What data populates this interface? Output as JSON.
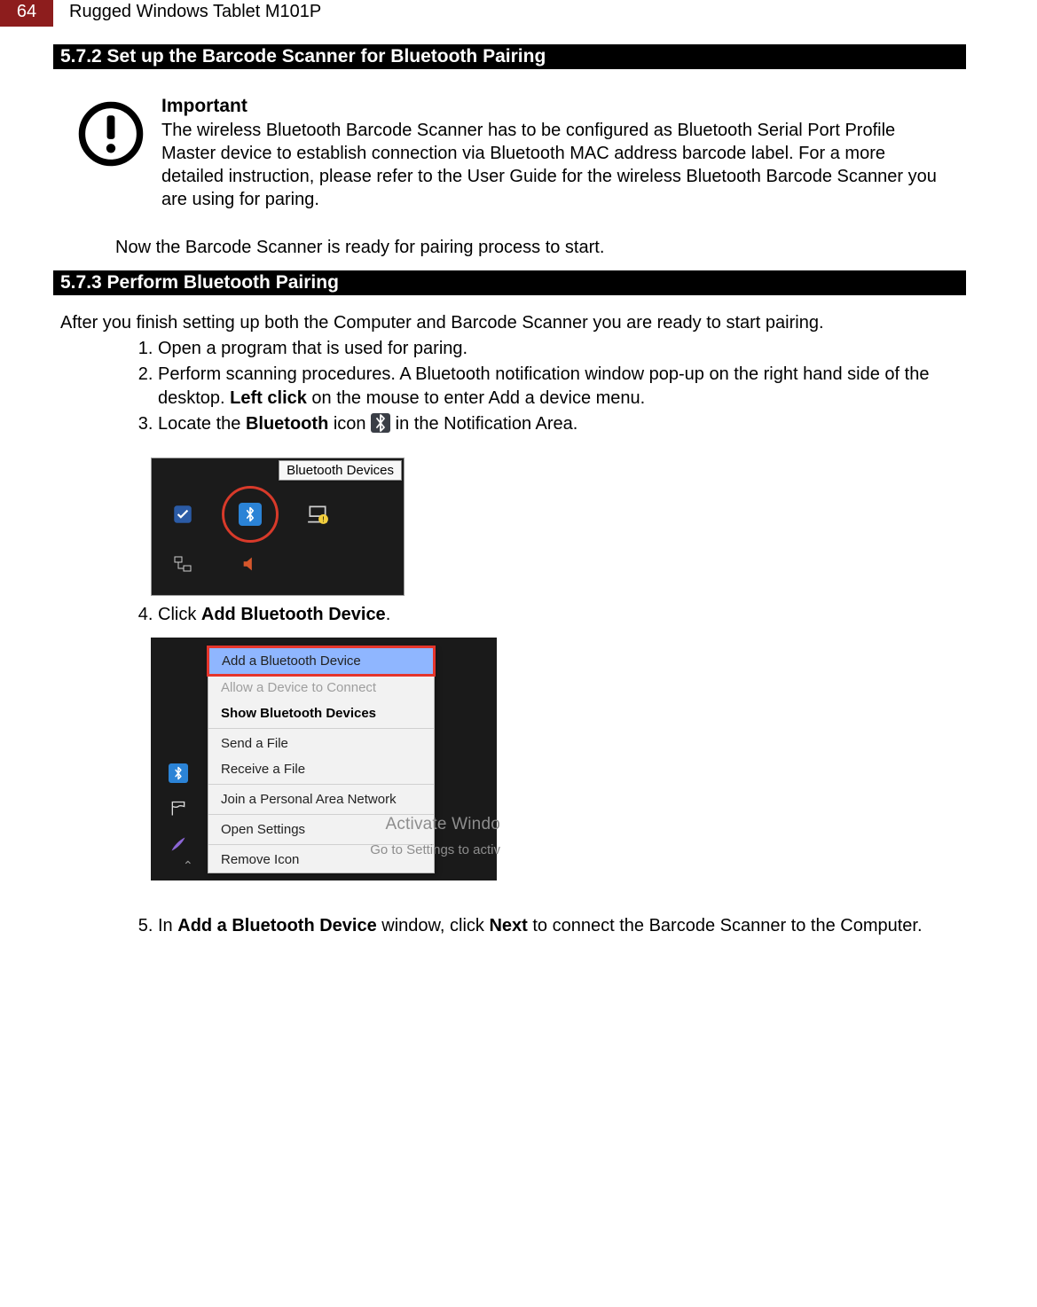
{
  "header": {
    "page_number": "64",
    "title": "Rugged Windows Tablet M101P"
  },
  "section1": {
    "heading": "5.7.2 Set up the Barcode Scanner for Bluetooth Pairing",
    "note_title": "Important",
    "note_body": "The wireless Bluetooth Barcode Scanner has to be configured as Bluetooth Serial Port Profile Master device to establish connection via Bluetooth MAC address barcode label. For a more detailed instruction, please refer to the User Guide for the wireless Bluetooth Barcode Scanner you are using for paring.",
    "ready_line": "Now the Barcode Scanner is ready for pairing process to start."
  },
  "section2": {
    "heading": "5.7.3 Perform Bluetooth Pairing",
    "intro": "After you finish setting up both the Computer and Barcode Scanner you are ready to start pairing.",
    "step1": "Open a program that is used for paring.",
    "step2_a": "Perform scanning procedures. A Bluetooth notification window pop-up on the right hand side of the desktop. ",
    "step2_bold": "Left click",
    "step2_b": " on the mouse to enter Add a device menu.",
    "step3_a": "Locate the ",
    "step3_bold": "Bluetooth",
    "step3_b": " icon ",
    "step3_c": " in the Notification Area.",
    "step4_a": "Click ",
    "step4_bold": "Add Bluetooth Device",
    "step4_b": ".",
    "step5_a": "In ",
    "step5_bold1": "Add a Bluetooth Device",
    "step5_b": " window, click ",
    "step5_bold2": "Next",
    "step5_c": " to connect the Barcode Scanner to the Computer."
  },
  "tray_shot": {
    "tooltip": "Bluetooth Devices"
  },
  "ctx_shot": {
    "items": {
      "add": "Add a Bluetooth Device",
      "allow": "Allow a Device to Connect",
      "show": "Show Bluetooth Devices",
      "send": "Send a File",
      "receive": "Receive a File",
      "join": "Join a Personal Area Network",
      "open": "Open Settings",
      "remove": "Remove Icon"
    },
    "watermark1": "Activate Windo",
    "watermark2": "Go to Settings to activ"
  }
}
